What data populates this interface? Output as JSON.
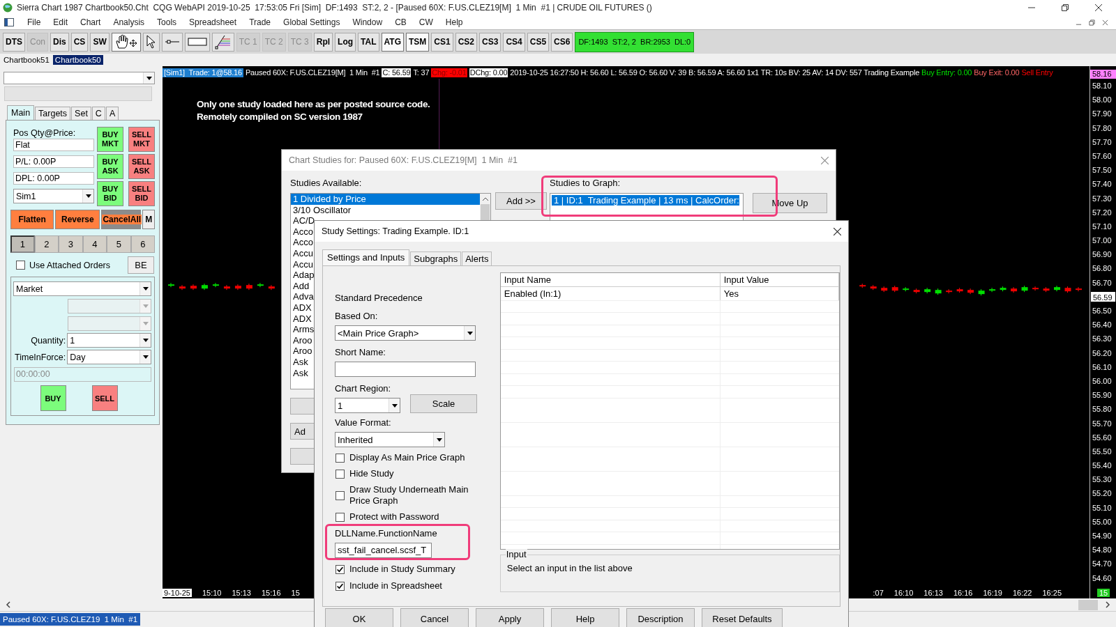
{
  "title_bar": {
    "title": "Sierra Chart 1987 Chartbook50.Cht  CQG WebAPI 2019-10-25  17:53:05 Fri [Sim]  DF:1493  ST:2, 2 - [Paused 60X: F.US.CLEZ19[M]  1 Min  #1 | CRUDE OIL FUTURES ()"
  },
  "menu": [
    "File",
    "Edit",
    "Chart",
    "Analysis",
    "Tools",
    "Spreadsheet",
    "Trade",
    "Global Settings",
    "Window",
    "CB",
    "CW",
    "Help"
  ],
  "toolbar": [
    {
      "kind": "text",
      "label": "DTS",
      "disabled": false,
      "pressed": false
    },
    {
      "kind": "text",
      "label": "Con",
      "disabled": true,
      "pressed": false
    },
    {
      "kind": "text",
      "label": "Dis",
      "disabled": false,
      "pressed": false
    },
    {
      "kind": "text",
      "label": "CS",
      "disabled": false,
      "pressed": false
    },
    {
      "kind": "text",
      "label": "SW",
      "disabled": false,
      "pressed": false
    },
    {
      "kind": "hand",
      "pressed": true
    },
    {
      "kind": "pointer",
      "pressed": false
    },
    {
      "kind": "line",
      "pressed": false
    },
    {
      "kind": "rectangle",
      "pressed": false
    },
    {
      "kind": "fan",
      "pressed": false
    },
    {
      "kind": "text",
      "label": "TC 1",
      "disabled": true,
      "pressed": false
    },
    {
      "kind": "text",
      "label": "TC 2",
      "disabled": true,
      "pressed": false
    },
    {
      "kind": "text",
      "label": "TC 3",
      "disabled": true,
      "pressed": false
    },
    {
      "kind": "text",
      "label": "Rpl",
      "disabled": false,
      "pressed": false
    },
    {
      "kind": "text",
      "label": "Log",
      "disabled": false,
      "pressed": false
    },
    {
      "kind": "text",
      "label": "TAL",
      "disabled": false,
      "pressed": false
    },
    {
      "kind": "text",
      "label": "ATG",
      "disabled": false,
      "pressed": true
    },
    {
      "kind": "text",
      "label": "TSM",
      "disabled": false,
      "pressed": true
    },
    {
      "kind": "text",
      "label": "CS1",
      "disabled": false,
      "pressed": false
    },
    {
      "kind": "text",
      "label": "CS2",
      "disabled": false,
      "pressed": false
    },
    {
      "kind": "text",
      "label": "CS3",
      "disabled": false,
      "pressed": false
    },
    {
      "kind": "text",
      "label": "CS4",
      "disabled": false,
      "pressed": false
    },
    {
      "kind": "text",
      "label": "CS5",
      "disabled": false,
      "pressed": false
    },
    {
      "kind": "text",
      "label": "CS6",
      "disabled": false,
      "pressed": false
    }
  ],
  "status_badge": "DF:1493  ST:2, 2  BR:2953  DL:0",
  "chartbook_tabs": [
    {
      "label": "Chartbook51",
      "selected": false
    },
    {
      "label": "Chartbook50",
      "selected": true
    }
  ],
  "order_panel": {
    "tabs": [
      {
        "label": "Main",
        "selected": true
      },
      {
        "label": "Targets",
        "selected": false
      },
      {
        "label": "Set",
        "selected": false
      },
      {
        "label": "C",
        "selected": false
      },
      {
        "label": "A",
        "selected": false
      }
    ],
    "position_label": "Pos Qty@Price:",
    "position": "Flat",
    "pl": "P/L: 0.00P",
    "dpl": "DPL: 0.00P",
    "account": "Sim1",
    "trade_buttons": [
      {
        "kind": "buy",
        "label": "BUY MKT"
      },
      {
        "kind": "sell",
        "label": "SELL MKT"
      },
      {
        "kind": "buy",
        "label": "BUY ASK"
      },
      {
        "kind": "sell",
        "label": "SELL ASK"
      },
      {
        "kind": "buy",
        "label": "BUY BID"
      },
      {
        "kind": "sell",
        "label": "SELL BID"
      }
    ],
    "actions": [
      {
        "kind": "primary",
        "label": "Flatten"
      },
      {
        "kind": "primary",
        "label": "Reverse"
      },
      {
        "kind": "cancel",
        "label": "CancelAll"
      },
      {
        "kind": "plain",
        "label": "M"
      }
    ],
    "quantity_presets": [
      {
        "label": "1",
        "selected": true
      },
      {
        "label": "2",
        "selected": false
      },
      {
        "label": "3",
        "selected": false
      },
      {
        "label": "4",
        "selected": false
      },
      {
        "label": "5",
        "selected": false
      },
      {
        "label": "6",
        "selected": false
      }
    ],
    "attached_orders": {
      "label": "Use Attached Orders",
      "checked": false
    },
    "be_button": "BE",
    "order_type": "Market",
    "quantity_label": "Quantity:",
    "quantity": "1",
    "tif_label": "TimeInForce:",
    "tif": "Day",
    "time": "00:00:00",
    "buy": "BUY",
    "sell": "SELL"
  },
  "chart": {
    "header": [
      {
        "kind": "account",
        "text": "[Sim1]  Trade: 1@58.16"
      },
      {
        "kind": "plain",
        "text": "Paused 60X: F.US.CLEZ19[M]  1 Min  #1"
      },
      {
        "kind": "boxed",
        "text": "C: 56.59"
      },
      {
        "kind": "plain",
        "text": "T: 37"
      },
      {
        "kind": "alert",
        "text": "Chg: -0.01"
      },
      {
        "kind": "boxed",
        "text": "DChg: 0.00"
      },
      {
        "kind": "plain",
        "text": "2019-10-25 16:27:50 H: 56.60 L: 56.59 O: 56.60 V: 39 B: 56.59 A: 56.60 1x1 TR: 10s BV: 25 AV: 14 DV: 557 Trading Example"
      },
      {
        "kind": "signal",
        "text": "Buy Entry: 0.00",
        "color": "#00e000"
      },
      {
        "kind": "signal",
        "text": "Buy Exit: 0.00",
        "color": "#ff6666"
      },
      {
        "kind": "signal",
        "text": "Sell Entry",
        "color": "#ff0000"
      }
    ],
    "note": [
      "Only one study loaded here as per posted source code.",
      "Remotely compiled on SC version 1987"
    ],
    "price_axis": [
      {
        "kind": "last",
        "label": "58.16"
      },
      {
        "kind": "tick",
        "label": "58.10"
      },
      {
        "kind": "tick",
        "label": "58.00"
      },
      {
        "kind": "tick",
        "label": "57.90"
      },
      {
        "kind": "tick",
        "label": "57.80"
      },
      {
        "kind": "tick",
        "label": "57.70"
      },
      {
        "kind": "tick",
        "label": "57.60"
      },
      {
        "kind": "tick",
        "label": "57.50"
      },
      {
        "kind": "tick",
        "label": "57.40"
      },
      {
        "kind": "tick",
        "label": "57.30"
      },
      {
        "kind": "tick",
        "label": "57.20"
      },
      {
        "kind": "tick",
        "label": "57.10"
      },
      {
        "kind": "tick",
        "label": "57.00"
      },
      {
        "kind": "tick",
        "label": "56.90"
      },
      {
        "kind": "tick",
        "label": "56.80"
      },
      {
        "kind": "tick",
        "label": "56.70"
      },
      {
        "kind": "current",
        "label": "56.59"
      },
      {
        "kind": "tick",
        "label": "56.50"
      },
      {
        "kind": "tick",
        "label": "56.40"
      },
      {
        "kind": "tick",
        "label": "56.30"
      },
      {
        "kind": "tick",
        "label": "56.20"
      },
      {
        "kind": "tick",
        "label": "56.10"
      },
      {
        "kind": "tick",
        "label": "56.00"
      },
      {
        "kind": "tick",
        "label": "55.90"
      },
      {
        "kind": "tick",
        "label": "55.80"
      },
      {
        "kind": "tick",
        "label": "55.70"
      },
      {
        "kind": "tick",
        "label": "55.60"
      },
      {
        "kind": "tick",
        "label": "55.50"
      },
      {
        "kind": "tick",
        "label": "55.40"
      },
      {
        "kind": "tick",
        "label": "55.30"
      },
      {
        "kind": "tick",
        "label": "55.20"
      },
      {
        "kind": "tick",
        "label": "55.10"
      },
      {
        "kind": "tick",
        "label": "55.00"
      },
      {
        "kind": "tick",
        "label": "54.90"
      },
      {
        "kind": "tick",
        "label": "54.80"
      },
      {
        "kind": "tick",
        "label": "54.70"
      },
      {
        "kind": "tick",
        "label": "54.60"
      }
    ],
    "time_axis_left": [
      {
        "kind": "date",
        "label": "9-10-25"
      },
      {
        "kind": "time",
        "label": "15:10"
      },
      {
        "kind": "time",
        "label": "15:13"
      },
      {
        "kind": "time",
        "label": "15:16"
      },
      {
        "kind": "time",
        "label": "15"
      }
    ],
    "time_axis_right": [
      {
        "kind": "time",
        "label": ":07"
      },
      {
        "kind": "time",
        "label": "16:10"
      },
      {
        "kind": "time",
        "label": "16:13"
      },
      {
        "kind": "time",
        "label": "16:16"
      },
      {
        "kind": "time",
        "label": "16:19"
      },
      {
        "kind": "time",
        "label": "16:22"
      },
      {
        "kind": "time",
        "label": "16:25"
      }
    ],
    "bar_count": "15"
  },
  "chart_studies_dialog": {
    "title": "Chart Studies for: Paused 60X: F.US.CLEZ19[M]  1 Min  #1",
    "available_label": "Studies Available:",
    "available": [
      {
        "label": "1 Divided by Price",
        "selected": true
      },
      {
        "label": "3/10 Oscillator",
        "selected": false
      },
      {
        "label": "AC/D",
        "selected": false
      },
      {
        "label": "Acco",
        "selected": false
      },
      {
        "label": "Acco",
        "selected": false
      },
      {
        "label": "Accu",
        "selected": false
      },
      {
        "label": "Accu",
        "selected": false
      },
      {
        "label": "Adap",
        "selected": false
      },
      {
        "label": "Add",
        "selected": false
      },
      {
        "label": "Adva",
        "selected": false
      },
      {
        "label": "ADX",
        "selected": false
      },
      {
        "label": "ADX",
        "selected": false
      },
      {
        "label": "Arms",
        "selected": false
      },
      {
        "label": "Aroo",
        "selected": false
      },
      {
        "label": "Aroo",
        "selected": false
      },
      {
        "label": "Ask",
        "selected": false
      },
      {
        "label": "Ask",
        "selected": false
      }
    ],
    "add_button": "Add >>",
    "graph_label": "Studies to Graph:",
    "graph": [
      {
        "label": "1 | ID:1  Trading Example | 13 ms | CalcOrder:",
        "selected": true
      }
    ],
    "move_up": "Move Up",
    "lower_button": "Ad"
  },
  "study_settings_dialog": {
    "title": "Study Settings: Trading Example. ID:1",
    "tabs": [
      {
        "label": "Settings and Inputs",
        "selected": true
      },
      {
        "label": "Subgraphs",
        "selected": false
      },
      {
        "label": "Alerts",
        "selected": false
      }
    ],
    "precedence": "Standard Precedence",
    "based_on_label": "Based On:",
    "based_on": "<Main Price Graph>",
    "short_name_label": "Short Name:",
    "region_label": "Chart Region:",
    "region": "1",
    "scale_button": "Scale",
    "format_label": "Value Format:",
    "format": "Inherited",
    "options": [
      {
        "label": "Display As Main Price Graph",
        "checked": false
      },
      {
        "label": "Hide Study",
        "checked": false
      },
      {
        "label": "Draw Study Underneath Main Price Graph",
        "checked": false
      },
      {
        "label": "Protect with Password",
        "checked": false
      }
    ],
    "dll_label": "DLLName.FunctionName",
    "dll": "sst_fail_cancel.scsf_T",
    "summary_options": [
      {
        "label": "Include in Study Summary",
        "checked": true
      },
      {
        "label": "Include in Spreadsheet",
        "checked": true
      }
    ],
    "table": {
      "columns": [
        "Input Name",
        "Input Value"
      ],
      "rows": [
        [
          "Enabled  (In:1)",
          "Yes"
        ]
      ]
    },
    "input_group": {
      "title": "Input",
      "text": "Select an input in the list above"
    },
    "buttons": [
      "OK",
      "Cancel",
      "Apply",
      "Help",
      "Description",
      "Reset Defaults"
    ]
  },
  "status_bar": {
    "text": "Paused 60X: F.US.CLEZ19  1 Min  #1"
  }
}
